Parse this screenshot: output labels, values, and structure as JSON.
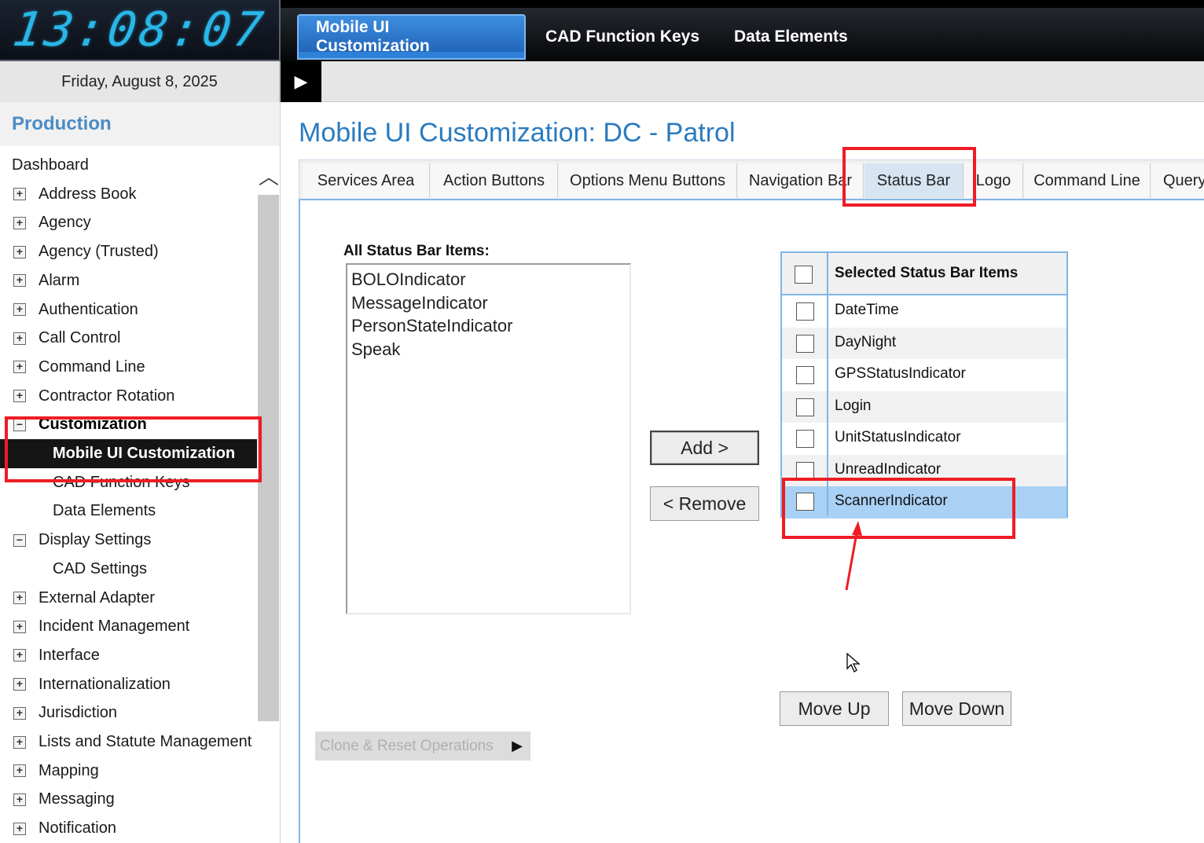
{
  "clock": {
    "time": "13:08:07"
  },
  "date": {
    "label": "Friday, August 8, 2025"
  },
  "environment": {
    "label": "Production"
  },
  "top_tabs": [
    {
      "label": "Mobile UI Customization",
      "active": true
    },
    {
      "label": "CAD Function Keys"
    },
    {
      "label": "Data Elements"
    }
  ],
  "nav": {
    "items": [
      {
        "label": "Dashboard",
        "toggle": ""
      },
      {
        "label": "Address Book",
        "toggle": "+"
      },
      {
        "label": "Agency",
        "toggle": "+"
      },
      {
        "label": "Agency (Trusted)",
        "toggle": "+"
      },
      {
        "label": "Alarm",
        "toggle": "+"
      },
      {
        "label": "Authentication",
        "toggle": "+"
      },
      {
        "label": "Call Control",
        "toggle": "+"
      },
      {
        "label": "Command Line",
        "toggle": "+"
      },
      {
        "label": "Contractor Rotation",
        "toggle": "+"
      },
      {
        "label": "Customization",
        "toggle": "−"
      },
      {
        "label": "Mobile UI Customization",
        "selected": true
      },
      {
        "label": "CAD Function Keys"
      },
      {
        "label": "Data Elements"
      },
      {
        "label": "Display Settings",
        "toggle": "−"
      },
      {
        "label": "CAD Settings"
      },
      {
        "label": "External Adapter",
        "toggle": "+"
      },
      {
        "label": "Incident Management",
        "toggle": "+"
      },
      {
        "label": "Interface",
        "toggle": "+"
      },
      {
        "label": "Internationalization",
        "toggle": "+"
      },
      {
        "label": "Jurisdiction",
        "toggle": "+"
      },
      {
        "label": "Lists and Statute Management",
        "toggle": "+"
      },
      {
        "label": "Mapping",
        "toggle": "+"
      },
      {
        "label": "Messaging",
        "toggle": "+"
      },
      {
        "label": "Notification",
        "toggle": "+"
      }
    ]
  },
  "page": {
    "title": "Mobile UI Customization: DC - Patrol"
  },
  "sub_tabs": [
    {
      "label": "Services Area"
    },
    {
      "label": "Action Buttons"
    },
    {
      "label": "Options Menu Buttons"
    },
    {
      "label": "Navigation Bar"
    },
    {
      "label": "Status Bar",
      "active": true
    },
    {
      "label": "Logo"
    },
    {
      "label": "Command Line"
    },
    {
      "label": "Query"
    }
  ],
  "all_items": {
    "label": "All Status Bar Items:",
    "options": [
      "BOLOIndicator",
      "MessageIndicator",
      "PersonStateIndicator",
      "Speak"
    ]
  },
  "buttons": {
    "add": "Add >",
    "remove": "< Remove",
    "move_up": "Move Up",
    "move_down": "Move Down"
  },
  "selected_items": {
    "header": "Selected Status Bar Items",
    "rows": [
      {
        "label": "DateTime"
      },
      {
        "label": "DayNight"
      },
      {
        "label": "GPSStatusIndicator"
      },
      {
        "label": "Login"
      },
      {
        "label": "UnitStatusIndicator"
      },
      {
        "label": "UnreadIndicator"
      },
      {
        "label": "ScannerIndicator",
        "highlighted": true
      }
    ]
  },
  "clone_reset": {
    "label": "Clone & Reset Operations"
  },
  "colors": {
    "accent": "#2a7bbf",
    "annotation": "#ee1c25",
    "row_highlight": "#a9d1f5"
  }
}
